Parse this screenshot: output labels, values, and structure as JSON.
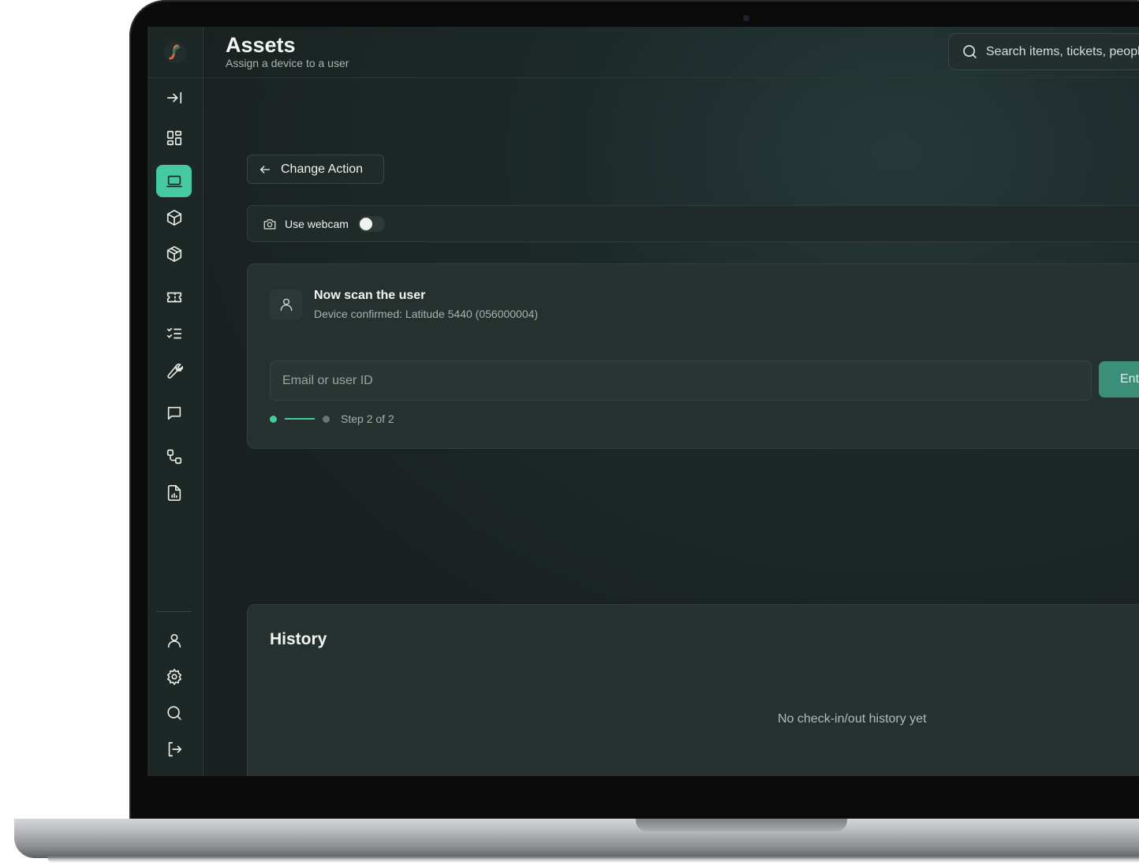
{
  "header": {
    "title": "Assets",
    "subtitle": "Assign a device to a user",
    "search_placeholder": "Search items, tickets, people"
  },
  "sidebar": {
    "top_items": [
      {
        "icon": "collapse-sidebar-icon"
      },
      {
        "icon": "dashboard-grid-icon"
      },
      {
        "icon": "laptop-icon",
        "active": true
      },
      {
        "icon": "box-icon"
      },
      {
        "icon": "package-icon"
      },
      {
        "icon": "ticket-icon"
      },
      {
        "icon": "checklist-icon"
      },
      {
        "icon": "wrench-icon"
      },
      {
        "icon": "chat-icon"
      },
      {
        "icon": "workflow-icon"
      },
      {
        "icon": "report-icon"
      }
    ],
    "bottom_items": [
      {
        "icon": "user-icon"
      },
      {
        "icon": "gear-icon"
      },
      {
        "icon": "search-icon"
      },
      {
        "icon": "logout-icon"
      }
    ]
  },
  "actions": {
    "change_action_label": "Change Action"
  },
  "webcam": {
    "label": "Use webcam",
    "enabled": false
  },
  "scan": {
    "title": "Now scan the user",
    "subtitle": "Device confirmed: Latitude 5440 (056000004)",
    "input_placeholder": "Email or user ID",
    "submit_label": "Enter",
    "step_label": "Step 2 of 2",
    "current_step": 2,
    "total_steps": 2
  },
  "history": {
    "title": "History",
    "empty_text": "No check-in/out history yet"
  },
  "colors": {
    "accent": "#45c9a0",
    "background": "#1d2a2a",
    "card": "#25302f"
  }
}
